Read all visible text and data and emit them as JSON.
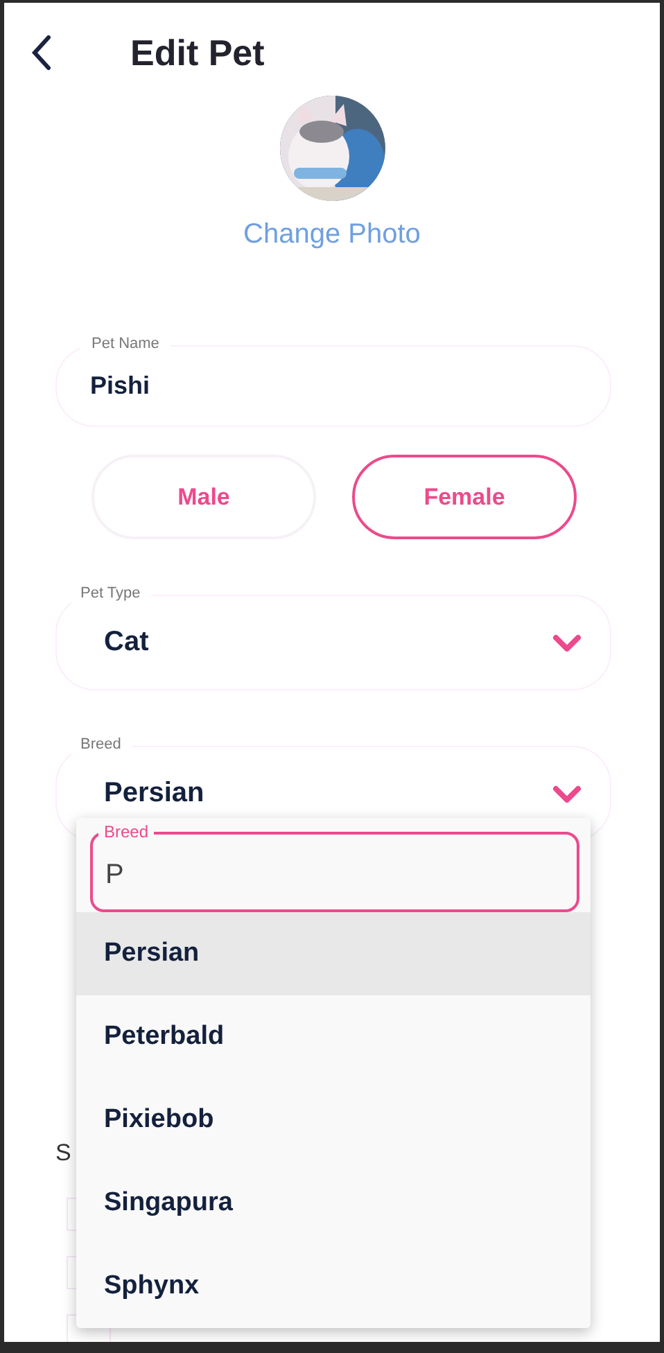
{
  "header": {
    "title": "Edit Pet"
  },
  "photo": {
    "kind": "picture",
    "action": "Change Photo"
  },
  "pet_name": {
    "label": "Pet Name",
    "value": "Pishi"
  },
  "gender": [
    {
      "label": "Male",
      "selected": false
    },
    {
      "label": "Female",
      "selected": true
    }
  ],
  "selects": [
    {
      "label": "Pet Type",
      "value": "Cat"
    },
    {
      "label": "Breed",
      "value": "Persian"
    }
  ],
  "covered_section": {
    "label": "S"
  },
  "dropdown": {
    "search_label": "Breed",
    "search_value": "P",
    "options": [
      {
        "label": "Persian",
        "selected": true
      },
      {
        "label": "Peterbald",
        "selected": false
      },
      {
        "label": "Pixiebob",
        "selected": false
      },
      {
        "label": "Singapura",
        "selected": false
      },
      {
        "label": "Sphynx",
        "selected": false
      }
    ]
  }
}
